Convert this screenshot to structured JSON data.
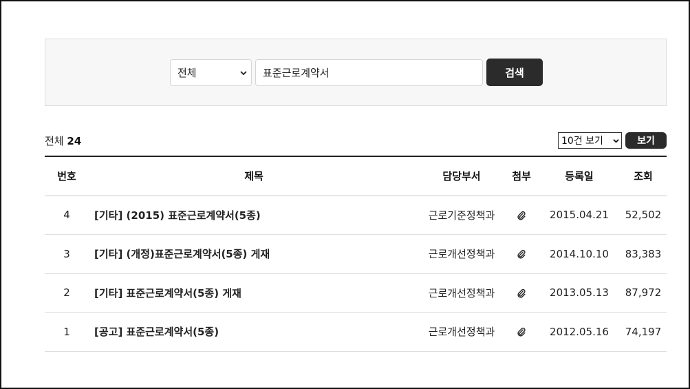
{
  "search": {
    "scope_selected": "전체",
    "keyword_value": "표준근로계약서",
    "button_label": "검색"
  },
  "summary": {
    "total_label": "전체",
    "total_count": "24"
  },
  "paging": {
    "per_page_selected": "10건 보기",
    "view_button_label": "보기"
  },
  "table": {
    "headers": {
      "no": "번호",
      "title": "제목",
      "dept": "담당부서",
      "attachment": "첨부",
      "date": "등록일",
      "views": "조회"
    },
    "rows": [
      {
        "no": "4",
        "title": "[기타] (2015) 표준근로계약서(5종)",
        "dept": "근로기준정책과",
        "date": "2015.04.21",
        "views": "52,502"
      },
      {
        "no": "3",
        "title": "[기타] (개정)표준근로계약서(5종) 게재",
        "dept": "근로개선정책과",
        "date": "2014.10.10",
        "views": "83,383"
      },
      {
        "no": "2",
        "title": "[기타] 표준근로계약서(5종) 게재",
        "dept": "근로개선정책과",
        "date": "2013.05.13",
        "views": "87,972"
      },
      {
        "no": "1",
        "title": "[공고] 표준근로계약서(5종)",
        "dept": "근로개선정책과",
        "date": "2012.05.16",
        "views": "74,197"
      }
    ]
  },
  "icons": {
    "attachment": "paperclip-icon",
    "dropdown": "chevron-down-icon"
  },
  "colors": {
    "button_bg": "#2b2b2b",
    "panel_bg": "#f7f7f7"
  }
}
